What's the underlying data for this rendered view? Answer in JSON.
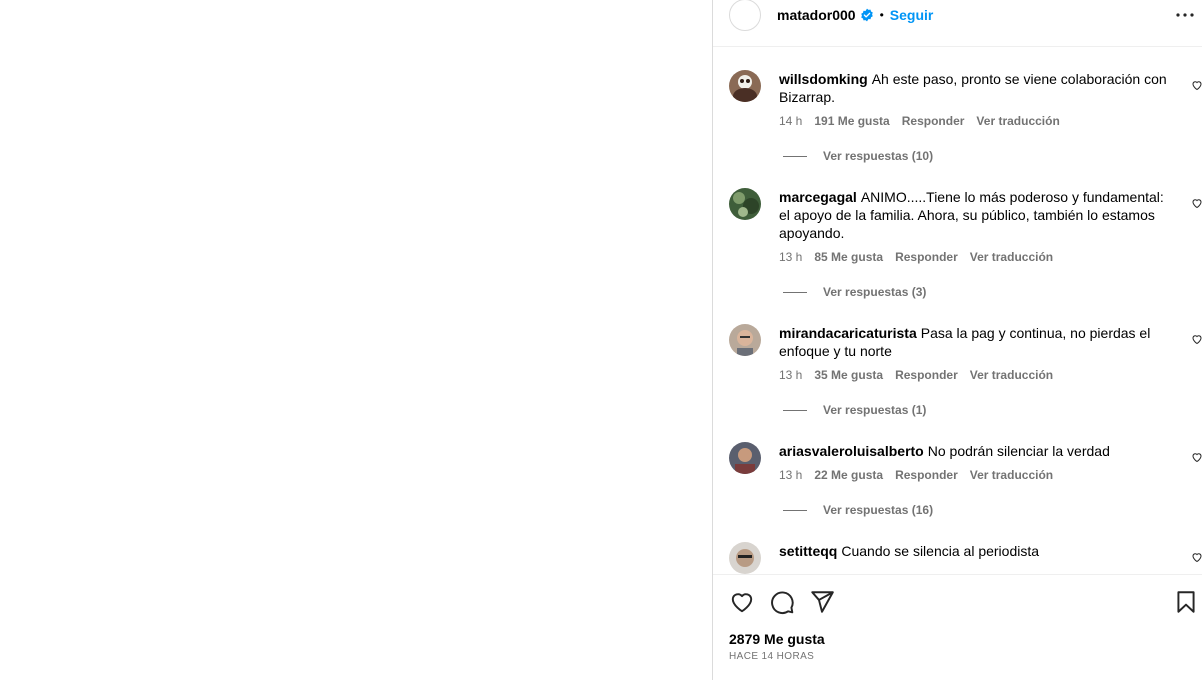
{
  "post": {
    "username": "matador000",
    "separator": "•",
    "follow_label": "Seguir",
    "likes_label": "2879 Me gusta",
    "time_label": "HACE 14 HORAS"
  },
  "comments": [
    {
      "user": "willsdomking",
      "text": "Ah este paso, pronto se viene colaboración con Bizarrap.",
      "time": "14 h",
      "likes": "191 Me gusta",
      "reply": "Responder",
      "translate": "Ver traducción",
      "replies": "Ver respuestas (10)"
    },
    {
      "user": "marcegagal",
      "text": "ANIMO.....Tiene lo más poderoso y fundamental: el apoyo de la familia. Ahora, su público, también lo estamos apoyando.",
      "time": "13 h",
      "likes": "85 Me gusta",
      "reply": "Responder",
      "translate": "Ver traducción",
      "replies": "Ver respuestas (3)"
    },
    {
      "user": "mirandacaricaturista",
      "text": "Pasa la pag y continua, no pierdas el enfoque y tu norte",
      "time": "13 h",
      "likes": "35 Me gusta",
      "reply": "Responder",
      "translate": "Ver traducción",
      "replies": "Ver respuestas (1)"
    },
    {
      "user": "ariasvaleroluisalberto",
      "text": "No podrán silenciar la verdad",
      "time": "13 h",
      "likes": "22 Me gusta",
      "reply": "Responder",
      "translate": "Ver traducción",
      "replies": "Ver respuestas (16)"
    },
    {
      "user": "setitteqq",
      "text": "Cuando se silencia al periodista"
    }
  ],
  "icons": {
    "verified": "verified-badge-icon",
    "more": "more-options-icon",
    "like": "heart-icon",
    "comment": "comment-icon",
    "share": "share-icon",
    "save": "bookmark-icon"
  },
  "colors": {
    "link": "#0095f6",
    "verified": "#0095f6",
    "muted": "#737373"
  }
}
